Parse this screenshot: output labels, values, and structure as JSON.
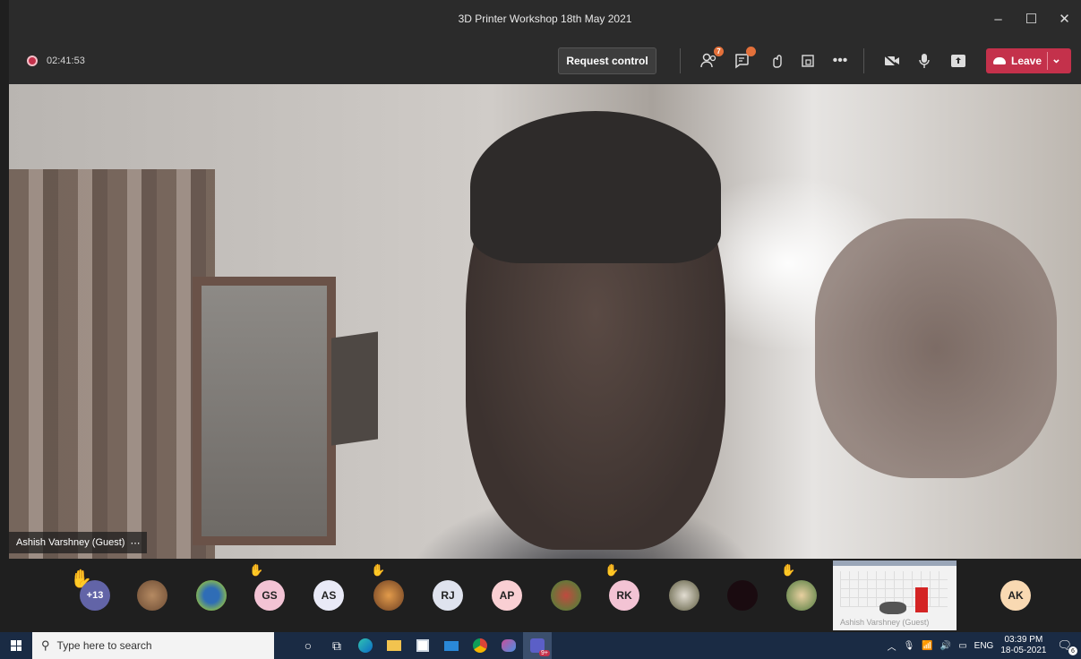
{
  "window": {
    "title": "3D Printer Workshop 18th May 2021",
    "controls": [
      "–",
      "☐",
      "✕"
    ]
  },
  "meeting": {
    "recording_time": "02:41:53",
    "request_control_label": "Request control",
    "participants_badge": "7",
    "leave_label": "Leave",
    "icons": [
      "participants-icon",
      "chat-icon",
      "reactions-icon",
      "rooms-icon",
      "more-icon",
      "camera-off-icon",
      "mic-icon",
      "share-icon"
    ]
  },
  "video": {
    "presenter_name": "Ashish Varshney (Guest)",
    "name_more": "⋯"
  },
  "participants": {
    "overflow_label": "+13",
    "initials": [
      {
        "initials": "GS",
        "color": "#f3c3d4"
      },
      {
        "initials": "AS",
        "color": "#e9eaf7"
      },
      {
        "initials": "RJ",
        "color": "#dfe3ee"
      },
      {
        "initials": "AP",
        "color": "#f9cfd3"
      },
      {
        "initials": "RK",
        "color": "#f3c3d4"
      },
      {
        "initials": "AK",
        "color": "#f9d9b2"
      }
    ],
    "share_caption": "Ashish Varshney (Guest)"
  },
  "taskbar": {
    "search_placeholder": "Type here to search",
    "language": "ENG",
    "time": "03:39 PM",
    "date": "18-05-2021",
    "notification_count": "6",
    "teams_badge": "9+"
  }
}
